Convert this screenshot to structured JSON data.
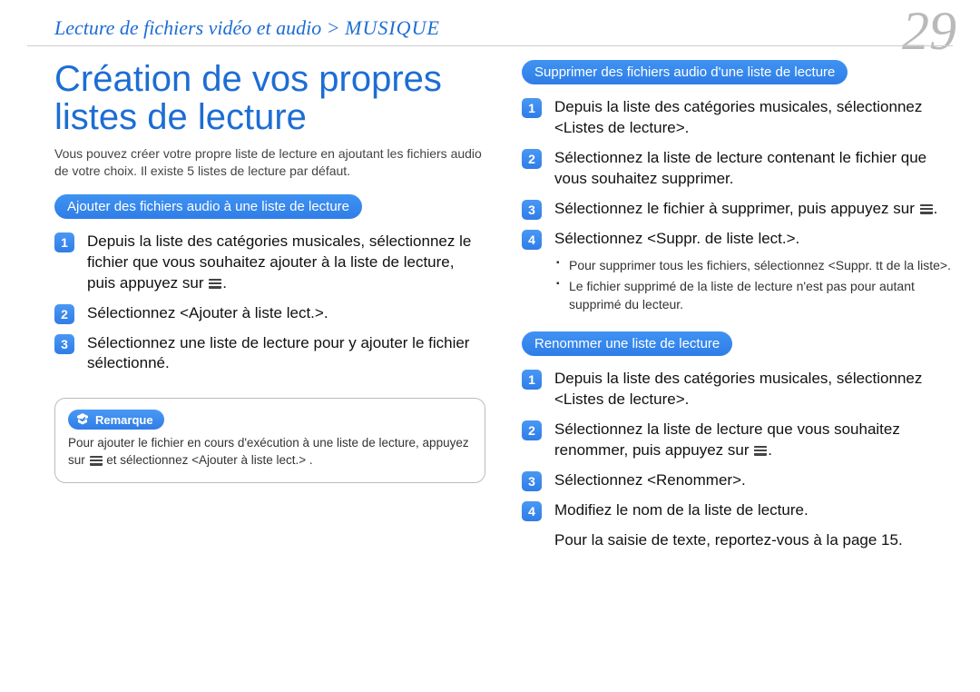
{
  "breadcrumb": {
    "path": "Lecture de fichiers vidéo et audio",
    "section": "MUSIQUE"
  },
  "page_number": "29",
  "title": "Création de vos propres listes de lecture",
  "intro": "Vous pouvez créer votre propre liste de lecture en ajoutant les fichiers audio de votre choix. Il existe 5 listes de lecture par défaut.",
  "left": {
    "pill": "Ajouter des fichiers audio à une liste de lecture",
    "step1a": "Depuis la liste des catégories musicales, sélectionnez le fichier que vous souhaitez ajouter à la liste de lecture, puis appuyez sur ",
    "step1b": ".",
    "step2": "Sélectionnez <Ajouter à liste lect.>.",
    "step3": "Sélectionnez une liste de lecture pour y ajouter le fichier sélectionné.",
    "note_label": "Remarque",
    "note_a": "Pour ajouter le fichier en cours d'exécution à une liste de lecture, appuyez sur ",
    "note_b": " et sélectionnez <Ajouter à liste lect.> ."
  },
  "right": {
    "sec1": {
      "pill": "Supprimer des fichiers audio d'une liste de lecture",
      "step1": "Depuis la liste des catégories musicales, sélectionnez <Listes de lecture>.",
      "step2": "Sélectionnez la liste de lecture contenant le fichier que vous souhaitez supprimer.",
      "step3a": "Sélectionnez le fichier à supprimer, puis appuyez sur ",
      "step3b": ".",
      "step4": "Sélectionnez <Suppr. de liste lect.>.",
      "sub1": "Pour supprimer tous les fichiers, sélectionnez <Suppr. tt de la liste>.",
      "sub2": "Le fichier supprimé de la liste de lecture n'est pas pour autant supprimé du lecteur."
    },
    "sec2": {
      "pill": "Renommer une liste de lecture",
      "step1": "Depuis la liste des catégories musicales, sélectionnez <Listes de lecture>.",
      "step2a": "Sélectionnez la liste de lecture que vous souhaitez renommer, puis appuyez sur ",
      "step2b": ".",
      "step3": "Sélectionnez <Renommer>.",
      "step4": "Modifiez le nom de la liste de lecture.",
      "extra": "Pour la saisie de texte, reportez-vous à la page 15."
    }
  }
}
